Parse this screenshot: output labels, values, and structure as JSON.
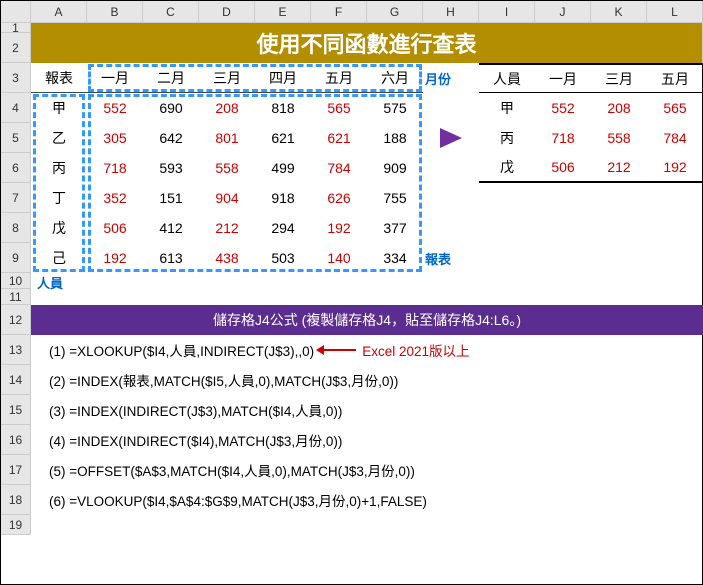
{
  "columns": [
    "A",
    "B",
    "C",
    "D",
    "E",
    "F",
    "G",
    "H",
    "I",
    "J",
    "K",
    "L"
  ],
  "rows": [
    "1",
    "2",
    "3",
    "4",
    "5",
    "6",
    "7",
    "8",
    "9",
    "10",
    "11",
    "12",
    "13",
    "14",
    "15",
    "16",
    "17",
    "18",
    "19"
  ],
  "title": "使用不同函數進行查表",
  "t1_header": [
    "報表",
    "一月",
    "二月",
    "三月",
    "四月",
    "五月",
    "六月"
  ],
  "t1_rows": [
    {
      "n": "甲",
      "v": [
        "552",
        "690",
        "208",
        "818",
        "565",
        "575"
      ]
    },
    {
      "n": "乙",
      "v": [
        "305",
        "642",
        "801",
        "621",
        "621",
        "188"
      ]
    },
    {
      "n": "丙",
      "v": [
        "718",
        "593",
        "558",
        "499",
        "784",
        "909"
      ]
    },
    {
      "n": "丁",
      "v": [
        "352",
        "151",
        "904",
        "918",
        "626",
        "755"
      ]
    },
    {
      "n": "戊",
      "v": [
        "506",
        "412",
        "212",
        "294",
        "192",
        "377"
      ]
    },
    {
      "n": "己",
      "v": [
        "192",
        "613",
        "438",
        "503",
        "140",
        "334"
      ]
    }
  ],
  "t1_red_cols": [
    0,
    2,
    4
  ],
  "label_month": "月份",
  "label_table": "報表",
  "label_person": "人員",
  "t2_header": [
    "人員",
    "一月",
    "三月",
    "五月"
  ],
  "t2_rows": [
    {
      "n": "甲",
      "v": [
        "552",
        "208",
        "565"
      ]
    },
    {
      "n": "丙",
      "v": [
        "718",
        "558",
        "784"
      ]
    },
    {
      "n": "戊",
      "v": [
        "506",
        "212",
        "192"
      ]
    }
  ],
  "banner2": "儲存格J4公式 (複製儲存格J4，貼至儲存格J4:L6。)",
  "formulas": [
    "(1) =XLOOKUP($I4,人員,INDIRECT(J$3),,0)",
    "(2) =INDEX(報表,MATCH($I5,人員,0),MATCH(J$3,月份,0))",
    "(3) =INDEX(INDIRECT(J$3),MATCH($I4,人員,0))",
    "(4) =INDEX(INDIRECT($I4),MATCH(J$3,月份,0))",
    "(5) =OFFSET($A$3,MATCH($I4,人員,0),MATCH(J$3,月份,0))",
    "(6) =VLOOKUP($I4,$A$4:$G$9,MATCH(J$3,月份,0)+1,FALSE)"
  ],
  "formula_note": "Excel 2021版以上"
}
